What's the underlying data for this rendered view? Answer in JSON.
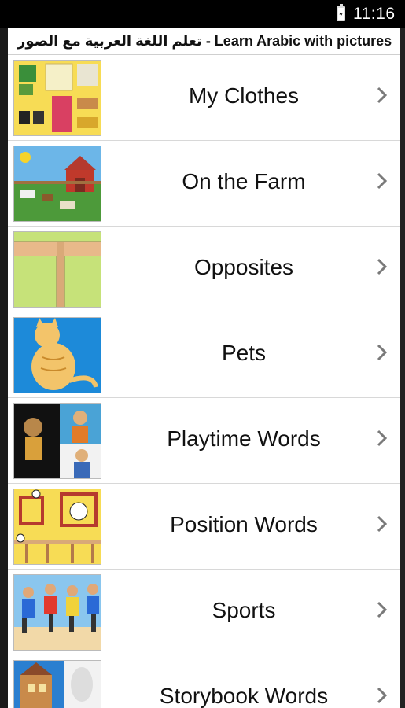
{
  "status_bar": {
    "time": "11:16",
    "battery_icon": "battery-charging-icon"
  },
  "app": {
    "title": "تعلم اللغة العربية مع الصور - Learn Arabic with pictures"
  },
  "categories": [
    {
      "label": "My Clothes",
      "icon": "clothes-thumbnail"
    },
    {
      "label": "On the Farm",
      "icon": "farm-thumbnail"
    },
    {
      "label": "Opposites",
      "icon": "opposites-thumbnail"
    },
    {
      "label": "Pets",
      "icon": "cat-thumbnail"
    },
    {
      "label": "Playtime Words",
      "icon": "playtime-thumbnail"
    },
    {
      "label": "Position Words",
      "icon": "position-thumbnail"
    },
    {
      "label": "Sports",
      "icon": "sports-thumbnail"
    },
    {
      "label": "Storybook Words",
      "icon": "storybook-thumbnail"
    }
  ],
  "colors": {
    "status_bar_bg": "#000000",
    "list_bg": "#ffffff",
    "divider": "#d8d8d8",
    "text": "#111111",
    "chevron": "#7a7a7a"
  }
}
